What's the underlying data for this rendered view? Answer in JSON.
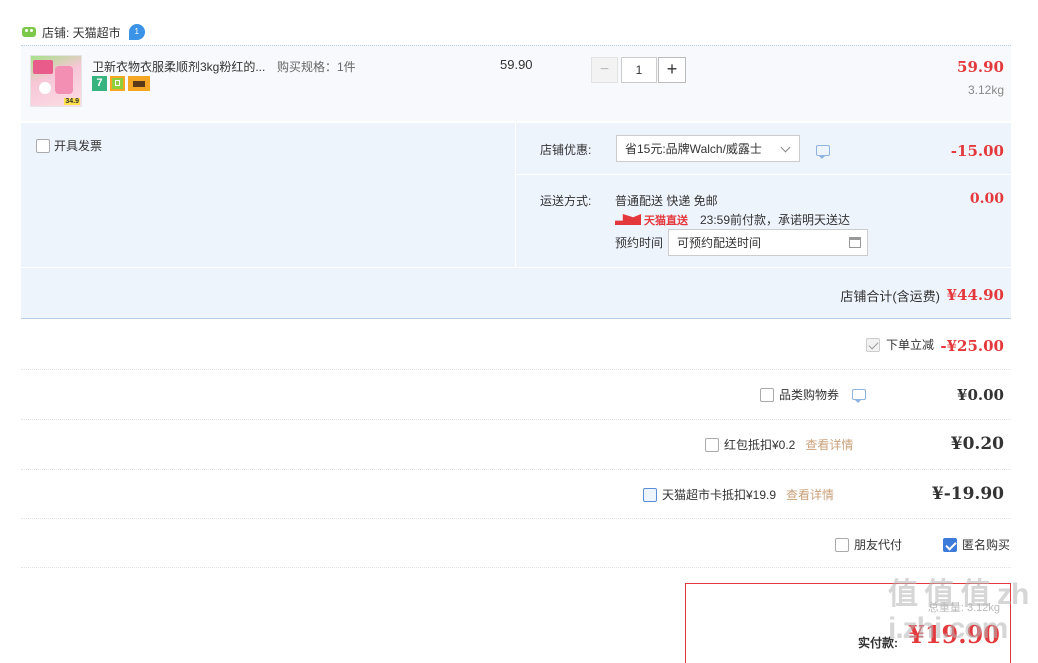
{
  "shop": {
    "label": "店铺: 天猫超市"
  },
  "item": {
    "title": "卫新衣物衣服柔顺剂3kg粉红的...",
    "spec": "购买规格：1件",
    "unit_price": "59.90",
    "quantity": "1",
    "minus": "−",
    "plus": "+",
    "subtotal": "59.90",
    "weight": "3.12kg",
    "thumb_price": "34.9",
    "badge_seven": "7"
  },
  "invoice": {
    "label": "开具发票"
  },
  "shop_discount": {
    "label": "店铺优惠:",
    "selected": "省15元:品牌Walch/威露士",
    "amount": "-15.00"
  },
  "shipping": {
    "label": "运送方式:",
    "method": "普通配送 快递 免邮",
    "direct_badge": "天猫直送",
    "promise": "23:59前付款，承诺明天送达",
    "schedule_label": "预约时间",
    "schedule_placeholder": "可预约配送时间",
    "amount": "0.00"
  },
  "shop_total": {
    "label": "店铺合计(含运费)",
    "amount": "¥44.90"
  },
  "order_discount": {
    "label": "下单立减",
    "amount": "-¥25.00"
  },
  "category_coupon": {
    "label": "品类购物券",
    "amount": "¥0.00"
  },
  "red_packet": {
    "label": "红包抵扣¥0.2",
    "link": "查看详情",
    "amount": "¥0.20"
  },
  "tmall_card": {
    "label": "天猫超市卡抵扣¥19.9",
    "link": "查看详情",
    "amount": "¥-19.90"
  },
  "options": {
    "friend_pay": "朋友代付",
    "anonymous": "匿名购买"
  },
  "payment": {
    "label": "实付款:",
    "amount": "¥19.90",
    "weight_hint": "总重量: 3.12kg"
  },
  "watermark": "值 值 值 zhi.zhi.com",
  "colors": {
    "accent_red": "#e4393c",
    "panel_blue": "#eef4fc",
    "link": "#c9a17a"
  }
}
